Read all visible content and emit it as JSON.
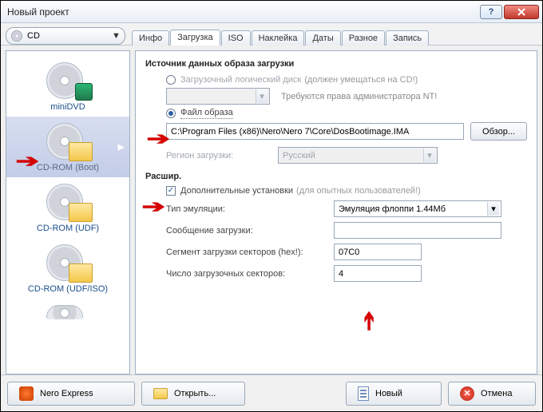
{
  "window": {
    "title": "Новый проект"
  },
  "media_selector": {
    "label": "CD"
  },
  "tabs": [
    {
      "label": "Инфо",
      "active": false
    },
    {
      "label": "Загрузка",
      "active": true
    },
    {
      "label": "ISO",
      "active": false
    },
    {
      "label": "Наклейка",
      "active": false
    },
    {
      "label": "Даты",
      "active": false
    },
    {
      "label": "Разное",
      "active": false
    },
    {
      "label": "Запись",
      "active": false
    }
  ],
  "project_types": {
    "items": [
      {
        "caption": "miniDVD",
        "selected": false,
        "iconKind": "minidvd"
      },
      {
        "caption": "CD-ROM (Boot)",
        "selected": true,
        "iconKind": "folder"
      },
      {
        "caption": "CD-ROM (UDF)",
        "selected": false,
        "iconKind": "folder"
      },
      {
        "caption": "CD-ROM (UDF/ISO)",
        "selected": false,
        "iconKind": "folder"
      }
    ]
  },
  "boot": {
    "section_title": "Источник данных образа загрузки",
    "radio_logical_label": "Загрузочный логический диск",
    "radio_logical_hint": "(должен умещаться на CD!)",
    "admin_warning": "Требуются права администратора NT!",
    "radio_image_label": "Файл образа",
    "image_path_value": "C:\\Program Files (x86)\\Nero\\Nero 7\\Core\\DosBootimage.IMA",
    "browse_label": "Обзор...",
    "region_label": "Регион загрузки:",
    "region_value": "Русский"
  },
  "advanced": {
    "section_title": "Расшир.",
    "checkbox_label": "Дополнительные установки",
    "checkbox_hint": "(для опытных пользователей!)",
    "emulation_label": "Тип эмуляции:",
    "emulation_value": "Эмуляция флоппи 1.44Мб",
    "message_label": "Сообщение загрузки:",
    "message_value": "",
    "segment_label": "Сегмент загрузки секторов (hex!):",
    "segment_value": "07C0",
    "count_label": "Число загрузочных секторов:",
    "count_value": "4"
  },
  "footer": {
    "nero_express": "Nero Express",
    "open": "Открыть...",
    "new": "Новый",
    "cancel": "Отмена"
  },
  "colors": {
    "accent": "#2a5fa0",
    "annotation": "#d60000"
  }
}
